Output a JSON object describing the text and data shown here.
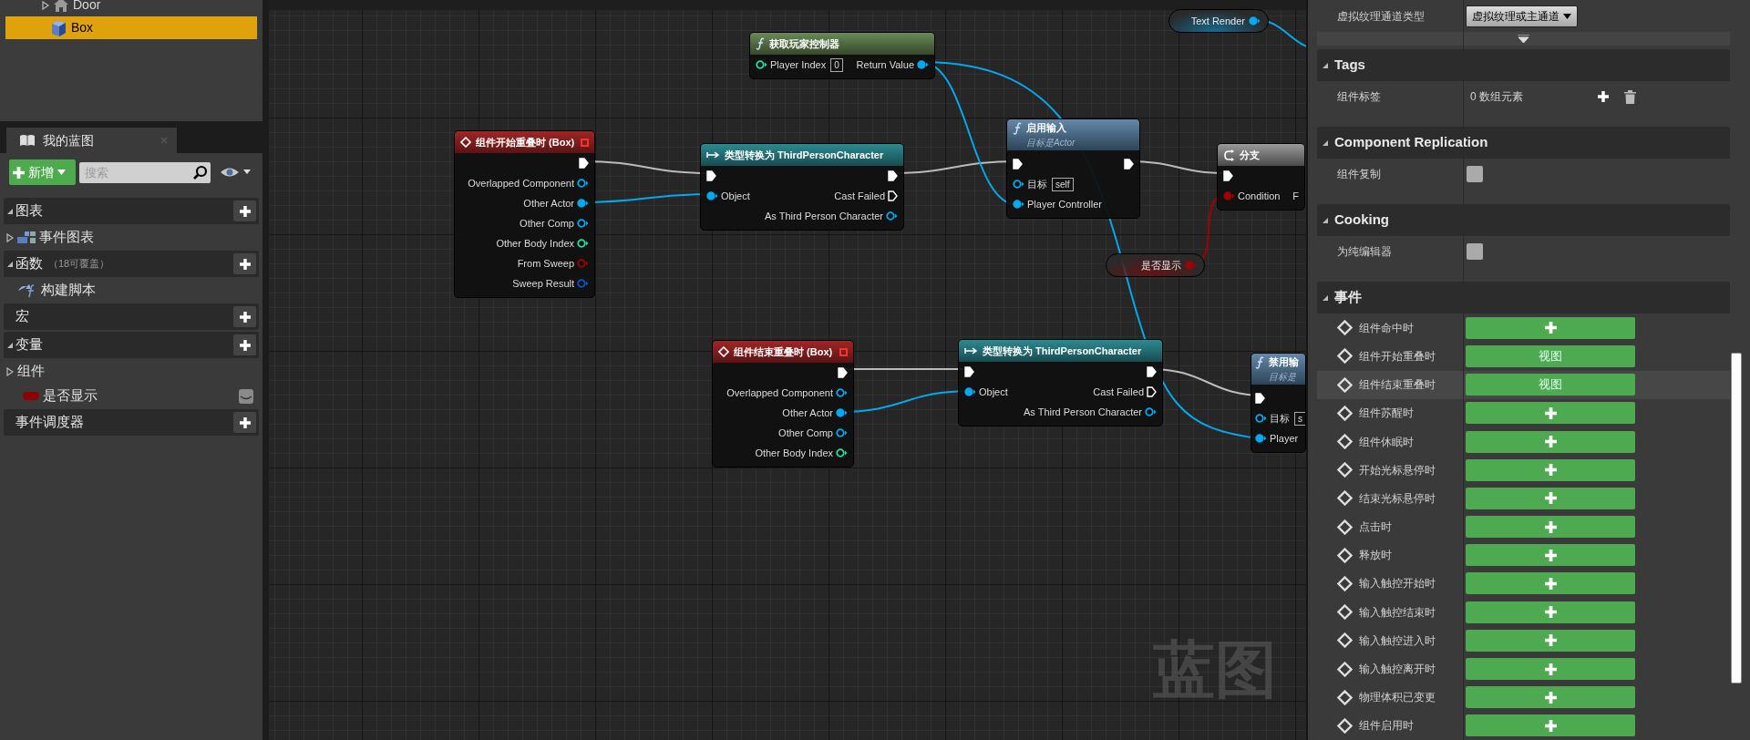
{
  "outliner": {
    "items": [
      {
        "label": "Door",
        "kind": "folder",
        "expanded": false,
        "selected": false
      },
      {
        "label": "Box",
        "kind": "box",
        "selected": true
      }
    ]
  },
  "my_blueprint": {
    "tab": "我的蓝图",
    "add_button": "新增",
    "search": {
      "placeholder": "搜索"
    },
    "sections": [
      {
        "kind": "header",
        "label": "图表",
        "expanded": true,
        "add": true
      },
      {
        "kind": "graph",
        "label": "事件图表",
        "expanded": false
      },
      {
        "kind": "header",
        "label": "函数",
        "note": "（18可覆盖）",
        "expanded": true,
        "add": true
      },
      {
        "kind": "function",
        "label": "构建脚本"
      },
      {
        "kind": "header",
        "label": "宏",
        "add": true
      },
      {
        "kind": "header",
        "label": "变量",
        "expanded": true,
        "add": true
      },
      {
        "kind": "category",
        "label": "组件",
        "expanded": false
      },
      {
        "kind": "variable",
        "label": "是否显示",
        "color": "#8c0000"
      },
      {
        "kind": "header",
        "label": "事件调度器",
        "add": true
      }
    ]
  },
  "graph": {
    "watermark": "蓝图",
    "nodes": [
      {
        "kind": "event",
        "title": "组件开始重叠时 (Box)",
        "outputs": [
          {
            "kind": "exec",
            "connected": true
          },
          {
            "label": "Overlapped Component",
            "kind": "object",
            "connected": false
          },
          {
            "label": "Other Actor",
            "kind": "object",
            "connected": true
          },
          {
            "label": "Other Comp",
            "kind": "object",
            "connected": false
          },
          {
            "label": "Other Body Index",
            "kind": "int",
            "connected": false
          },
          {
            "label": "From Sweep",
            "kind": "bool",
            "connected": false
          },
          {
            "label": "Sweep Result",
            "kind": "struct",
            "connected": false
          }
        ]
      },
      {
        "kind": "pure",
        "title": "获取玩家控制器",
        "inputs": [
          {
            "label": "Player Index",
            "kind": "int",
            "connected": false,
            "value": "0"
          }
        ],
        "outputs": [
          {
            "label": "Return Value",
            "kind": "object",
            "connected": true
          }
        ]
      },
      {
        "kind": "cast",
        "title": "类型转换为 ThirdPersonCharacter",
        "inputs": [
          {
            "kind": "exec",
            "connected": true
          },
          {
            "label": "Object",
            "kind": "object",
            "connected": true
          }
        ],
        "outputs": [
          {
            "kind": "exec",
            "connected": true
          },
          {
            "label": "Cast Failed",
            "kind": "exec",
            "connected": false
          },
          {
            "label": "As Third Person Character",
            "kind": "object",
            "connected": false
          }
        ]
      },
      {
        "kind": "function",
        "title": "启用输入",
        "subtitle": "目标是Actor",
        "inputs": [
          {
            "kind": "exec",
            "connected": true
          },
          {
            "label": "目标",
            "kind": "object",
            "connected": false,
            "value": "self"
          },
          {
            "label": "Player Controller",
            "kind": "object",
            "connected": true
          }
        ],
        "outputs": [
          {
            "kind": "exec",
            "connected": true
          }
        ]
      },
      {
        "kind": "branch",
        "title": "分支",
        "inputs": [
          {
            "kind": "exec",
            "connected": true
          },
          {
            "label": "Condition",
            "kind": "bool",
            "connected": true
          }
        ],
        "outputs": [
          {
            "label": "F"
          }
        ]
      },
      {
        "kind": "variable_get",
        "title": "是否显示",
        "outputs": [
          {
            "kind": "bool",
            "connected": true
          }
        ]
      },
      {
        "kind": "variable_get",
        "title": "Text Render",
        "outputs": [
          {
            "kind": "object",
            "connected": true
          }
        ]
      },
      {
        "kind": "event",
        "title": "组件结束重叠时 (Box)",
        "outputs": [
          {
            "kind": "exec",
            "connected": true
          },
          {
            "label": "Overlapped Component",
            "kind": "object",
            "connected": false
          },
          {
            "label": "Other Actor",
            "kind": "object",
            "connected": true
          },
          {
            "label": "Other Comp",
            "kind": "object",
            "connected": false
          },
          {
            "label": "Other Body Index",
            "kind": "int",
            "connected": false
          }
        ]
      },
      {
        "kind": "cast",
        "title": "类型转换为 ThirdPersonCharacter",
        "inputs": [
          {
            "kind": "exec",
            "connected": true
          },
          {
            "label": "Object",
            "kind": "object",
            "connected": true
          }
        ],
        "outputs": [
          {
            "kind": "exec",
            "connected": true
          },
          {
            "label": "Cast Failed",
            "kind": "exec",
            "connected": false
          },
          {
            "label": "As Third Person Character",
            "kind": "object",
            "connected": false
          }
        ]
      },
      {
        "kind": "function",
        "title": "禁用输",
        "subtitle": "目标是",
        "inputs": [
          {
            "kind": "exec",
            "connected": true
          },
          {
            "label": "目标",
            "kind": "object",
            "connected": false,
            "value": "s"
          },
          {
            "label": "Player",
            "kind": "object",
            "connected": true
          }
        ]
      }
    ]
  },
  "details": {
    "top_rows": [
      {
        "label": "虚拟纹理通道类型",
        "kind": "dropdown",
        "value": "虚拟纹理或主通道"
      }
    ],
    "sections": [
      {
        "title": "Tags",
        "expanded": true,
        "rows": [
          {
            "label": "组件标签",
            "kind": "array",
            "value": "0 数组元素"
          }
        ]
      },
      {
        "title": "Component Replication",
        "expanded": true,
        "rows": [
          {
            "label": "组件复制",
            "kind": "checkbox",
            "checked": false
          }
        ]
      },
      {
        "title": "Cooking",
        "expanded": true,
        "rows": [
          {
            "label": "为纯编辑器",
            "kind": "checkbox",
            "checked": false
          }
        ]
      },
      {
        "title": "事件",
        "expanded": true,
        "rows": [
          {
            "label": "组件命中时",
            "kind": "add",
            "highlighted": false
          },
          {
            "label": "组件开始重叠时",
            "kind": "view",
            "button": "视图",
            "highlighted": false
          },
          {
            "label": "组件结束重叠时",
            "kind": "view",
            "button": "视图",
            "highlighted": true
          },
          {
            "label": "组件苏醒时",
            "kind": "add",
            "highlighted": false
          },
          {
            "label": "组件休眠时",
            "kind": "add",
            "highlighted": false
          },
          {
            "label": "开始光标悬停时",
            "kind": "add",
            "highlighted": false
          },
          {
            "label": "结束光标悬停时",
            "kind": "add",
            "highlighted": false
          },
          {
            "label": "点击时",
            "kind": "add",
            "highlighted": false
          },
          {
            "label": "释放时",
            "kind": "add",
            "highlighted": false
          },
          {
            "label": "输入触控开始时",
            "kind": "add",
            "highlighted": false
          },
          {
            "label": "输入触控结束时",
            "kind": "add",
            "highlighted": false
          },
          {
            "label": "输入触控进入时",
            "kind": "add",
            "highlighted": false
          },
          {
            "label": "输入触控离开时",
            "kind": "add",
            "highlighted": false
          },
          {
            "label": "物理体积已变更",
            "kind": "add",
            "highlighted": false
          },
          {
            "label": "组件启用时",
            "kind": "add",
            "highlighted": false
          }
        ]
      }
    ]
  }
}
